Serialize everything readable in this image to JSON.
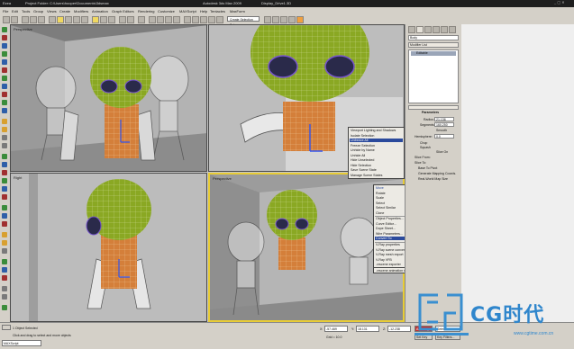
{
  "titlebar": {
    "app": "Ezea",
    "project": "Project Folder: C:\\Users\\hooper\\Documents\\3dsmax",
    "doc": "Autodesk 3ds Max 2009",
    "file": "Display_Drive1.3D"
  },
  "menu": [
    "File",
    "Edit",
    "Tools",
    "Group",
    "Views",
    "Create",
    "Modifiers",
    "Animation",
    "Graph Editors",
    "Rendering",
    "Customize",
    "MAXScript",
    "Help",
    "Tentacles",
    "MaxForm"
  ],
  "toolbar": {
    "selection_set": "Create Selection Set"
  },
  "viewports": {
    "top_left": "Perspective",
    "top_right": "",
    "bottom_left": "Right",
    "bottom_right": "Perspective"
  },
  "command_panel": {
    "object_name": "Body",
    "modifier_list": "Modifier List",
    "stack_item": "Editable",
    "rollout_title": "Parameters",
    "radius_label": "Radius:",
    "radius_value": "21.136",
    "segments_label": "Segments:",
    "segments_value": "160.250",
    "smooth_label": "Smooth",
    "hemisphere_label": "Hemisphere:",
    "hemisphere_value": "0.0",
    "chop_label": "Chop",
    "squash_label": "Squash",
    "slice_on_label": "Slice On",
    "slice_from_label": "Slice From:",
    "slice_to_label": "Slice To:",
    "base_pivot_label": "Base To Pivot",
    "gen_mapping": "Generate Mapping Coords.",
    "real_world": "Real-World Map Size"
  },
  "quad_upper": [
    "Viewport Lighting and Shadows",
    "Isolate Selection",
    "Unfreeze All",
    "Freeze Selection",
    "Unhide by Name",
    "Unhide All",
    "Hide Unselected",
    "Hide Selection",
    "Save Scene State",
    "Manage Scene States"
  ],
  "quad_lower": [
    "Move",
    "Rotate",
    "Scale",
    "Select",
    "Select Similar",
    "Clone",
    "Object Properties...",
    "Curve Editor...",
    "Dope Sheet...",
    "Wire Parameters...",
    "Convert To:",
    "V-Ray properties",
    "V-Ray scene converter",
    "V-Ray mesh export",
    "V-Ray VFB",
    ".vrscene exporter",
    ".vrscene animation exporter"
  ],
  "convert_submenu": [
    "Convert to Editable Mesh",
    "Convert to Editable Poly",
    "Convert to Editable Patch",
    "Convert to NURMS"
  ],
  "statusbar": {
    "objects": "1 Object Selected",
    "prompt": "Click and drag to select and move objects",
    "maxscript": "MAXScript",
    "x_label": "X:",
    "x_value": "-57.469",
    "y_label": "Y:",
    "y_value": "18.131",
    "z_label": "Z:",
    "z_value": "-12.238",
    "grid": "Grid = 10.0",
    "autokey": "Auto Key",
    "selected": "Selected",
    "setkey": "Set Key",
    "keyfilters": "Key Filters..."
  },
  "watermark": {
    "brand": "CG时代",
    "url": "www.cgtime.com.cn"
  },
  "colors": {
    "accent_yellow": "#e8cc36",
    "menu_highlight": "#2b4a9c",
    "head_green": "#8aa823",
    "neck_orange": "#d47f3a"
  }
}
